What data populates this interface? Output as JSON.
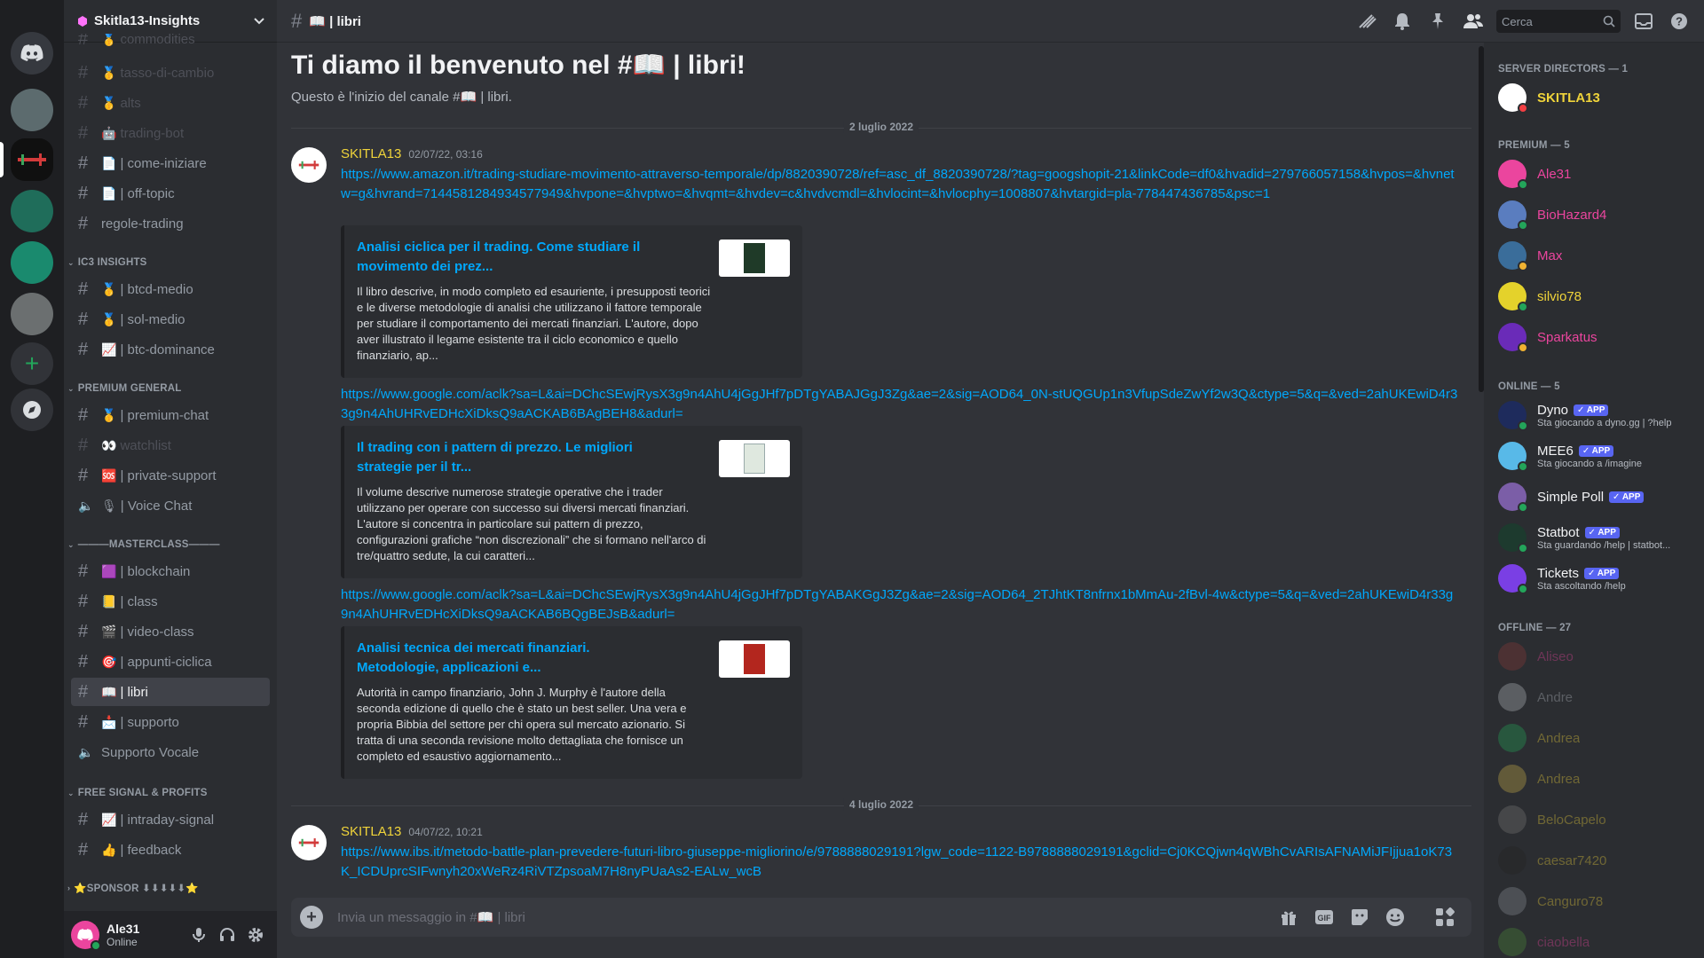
{
  "server": {
    "name": "Skitla13-Insights"
  },
  "channels": {
    "items": [
      {
        "name": "commodities",
        "emoji": "🥇",
        "muted": true
      },
      {
        "name": "tasso-di-cambio",
        "emoji": "🥇",
        "muted": true
      },
      {
        "name": "alts",
        "emoji": "🥇",
        "muted": true
      },
      {
        "name": "trading-bot",
        "emoji": "🤖",
        "muted": true
      },
      {
        "name": "| come-iniziare",
        "emoji": "📄",
        "muted": false
      },
      {
        "name": "| off-topic",
        "emoji": "📄",
        "muted": false
      },
      {
        "name": "regole-trading",
        "emoji": "",
        "muted": false
      }
    ],
    "cat_ic3": "IC3 INSIGHTS",
    "ic3": [
      {
        "name": "| btcd-medio",
        "emoji": "🥇"
      },
      {
        "name": "| sol-medio",
        "emoji": "🥇"
      },
      {
        "name": "| btc-dominance",
        "emoji": "📈"
      }
    ],
    "cat_premium": "PREMIUM GENERAL",
    "premium": [
      {
        "name": "| premium-chat",
        "emoji": "🥇"
      },
      {
        "name": "watchlist",
        "emoji": "👀"
      },
      {
        "name": "| private-support",
        "emoji": "🆘"
      },
      {
        "name": "| Voice Chat",
        "emoji": "🎙"
      }
    ],
    "cat_master": "———MASTERCLASS———",
    "master": [
      {
        "name": "| blockchain",
        "emoji": "🟪"
      },
      {
        "name": "| class",
        "emoji": "📒"
      },
      {
        "name": "| video-class",
        "emoji": "🎬"
      },
      {
        "name": "| appunti-ciclica",
        "emoji": "🎯"
      },
      {
        "name": "| libri",
        "emoji": "📖"
      },
      {
        "name": "| supporto",
        "emoji": "📩"
      },
      {
        "name": "Supporto Vocale",
        "emoji": ""
      }
    ],
    "cat_signal": "FREE SIGNAL & PROFITS",
    "signal": [
      {
        "name": "| intraday-signal",
        "emoji": "📈"
      },
      {
        "name": "| feedback",
        "emoji": "👍"
      }
    ],
    "cat_sponsor": "⭐SPONSOR ⬇⬇⬇⬇⬇⭐"
  },
  "user": {
    "name": "Ale31",
    "status": "Online"
  },
  "header": {
    "channel": "📖 | libri",
    "search_placeholder": "Cerca"
  },
  "main": {
    "welcome_title": "Ti diamo il benvenuto nel #📖 | libri!",
    "welcome_sub": "Questo è l'inizio del canale #📖 | libri.",
    "date1": "2 luglio 2022",
    "date2": "4 luglio 2022",
    "msg1": {
      "author": "SKITLA13",
      "time": "02/07/22, 03:16",
      "link1": "https://www.amazon.it/trading-studiare-movimento-attraverso-temporale/dp/8820390728/ref=asc_df_8820390728/?tag=googshopit-21&linkCode=df0&hvadid=279766057158&hvpos=&hvnetw=g&hvrand=7144581284934577949&hvpone=&hvptwo=&hvqmt=&hvdev=c&hvdvcmdl=&hvlocint=&hvlocphy=1008807&hvtargid=pla-778447436785&psc=1",
      "embed1_title": "Analisi ciclica per il trading. Come studiare il movimento dei prez...",
      "embed1_desc": "Il libro descrive, in modo completo ed esauriente, i presupposti teorici e le diverse metodologie di analisi che utilizzano il fattore temporale per studiare il comportamento dei mercati finanziari. L'autore, dopo aver illustrato il legame esistente tra il ciclo economico e quello finanziario, ap...",
      "link2": "https://www.google.com/aclk?sa=L&ai=DChcSEwjRysX3g9n4AhU4jGgJHf7pDTgYABAJGgJ3Zg&ae=2&sig=AOD64_0N-stUQGUp1n3VfupSdeZwYf2w3Q&ctype=5&q=&ved=2ahUKEwiD4r33g9n4AhUHRvEDHcXiDksQ9aACKAB6BAgBEH8&adurl=",
      "embed2_title": "Il trading con i pattern di prezzo. Le migliori strategie per il tr...",
      "embed2_desc": "Il volume descrive numerose strategie operative che i trader utilizzano per operare con successo sui diversi mercati finanziari. L'autore si concentra in particolare sui pattern di prezzo, configurazioni grafiche “non discrezionali” che si formano nell'arco di tre/quattro sedute, la cui caratteri...",
      "link3": "https://www.google.com/aclk?sa=L&ai=DChcSEwjRysX3g9n4AhU4jGgJHf7pDTgYABAKGgJ3Zg&ae=2&sig=AOD64_2TJhtKT8nfrnx1bMmAu-2fBvl-4w&ctype=5&q=&ved=2ahUKEwiD4r33g9n4AhUHRvEDHcXiDksQ9aACKAB6BQgBEJsB&adurl=",
      "embed3_title": "Analisi tecnica dei mercati finanziari. Metodologie, applicazioni e...",
      "embed3_desc": "Autorità in campo finanziario, John J. Murphy è l'autore della seconda edizione di quello che è stato un best seller. Una vera e propria Bibbia del settore per chi opera sul mercato azionario. Si tratta di una seconda revisione molto dettagliata che fornisce un completo ed esaustivo aggiornamento..."
    },
    "msg2": {
      "author": "SKITLA13",
      "time": "04/07/22, 10:21",
      "link1": "https://www.ibs.it/metodo-battle-plan-prevedere-futuri-libro-giuseppe-migliorino/e/9788888029191?lgw_code=1122-B9788888029191&gclid=Cj0KCQjwn4qWBhCvARIsAFNAMiJFIjjua1oK73K_ICDUprcSIFwnyh20xWeRz4RiVTZpsoaM7H8nyPUaAs2-EALw_wcB"
    },
    "composer_placeholder": "Invia un messaggio in #📖 | libri"
  },
  "members": {
    "g_directors": "SERVER DIRECTORS — 1",
    "g_premium": "PREMIUM — 5",
    "g_online": "ONLINE — 5",
    "g_offline": "OFFLINE — 27",
    "app_label": "✓ APP",
    "directors": [
      {
        "name": "SKITLA13",
        "color": "#f0d43a"
      }
    ],
    "premium": [
      {
        "name": "Ale31",
        "color": "#eb459e"
      },
      {
        "name": "BioHazard4",
        "color": "#eb459e"
      },
      {
        "name": "Max",
        "color": "#eb459e"
      },
      {
        "name": "silvio78",
        "color": "#f0d43a"
      },
      {
        "name": "Sparkatus",
        "color": "#eb459e"
      }
    ],
    "online": [
      {
        "name": "Dyno",
        "activity": "Sta giocando a dyno.gg | ?help"
      },
      {
        "name": "MEE6",
        "activity": "Sta giocando a /imagine"
      },
      {
        "name": "Simple Poll",
        "activity": ""
      },
      {
        "name": "Statbot",
        "activity": "Sta guardando /help | statbot..."
      },
      {
        "name": "Tickets",
        "activity": "Sta ascoltando /help"
      }
    ],
    "offline": [
      {
        "name": "Aliseo"
      },
      {
        "name": "Andre"
      },
      {
        "name": "Andrea"
      },
      {
        "name": "Andrea"
      },
      {
        "name": "BeloCapelo"
      },
      {
        "name": "caesar7420"
      },
      {
        "name": "Canguro78"
      },
      {
        "name": "ciaobella"
      }
    ]
  }
}
